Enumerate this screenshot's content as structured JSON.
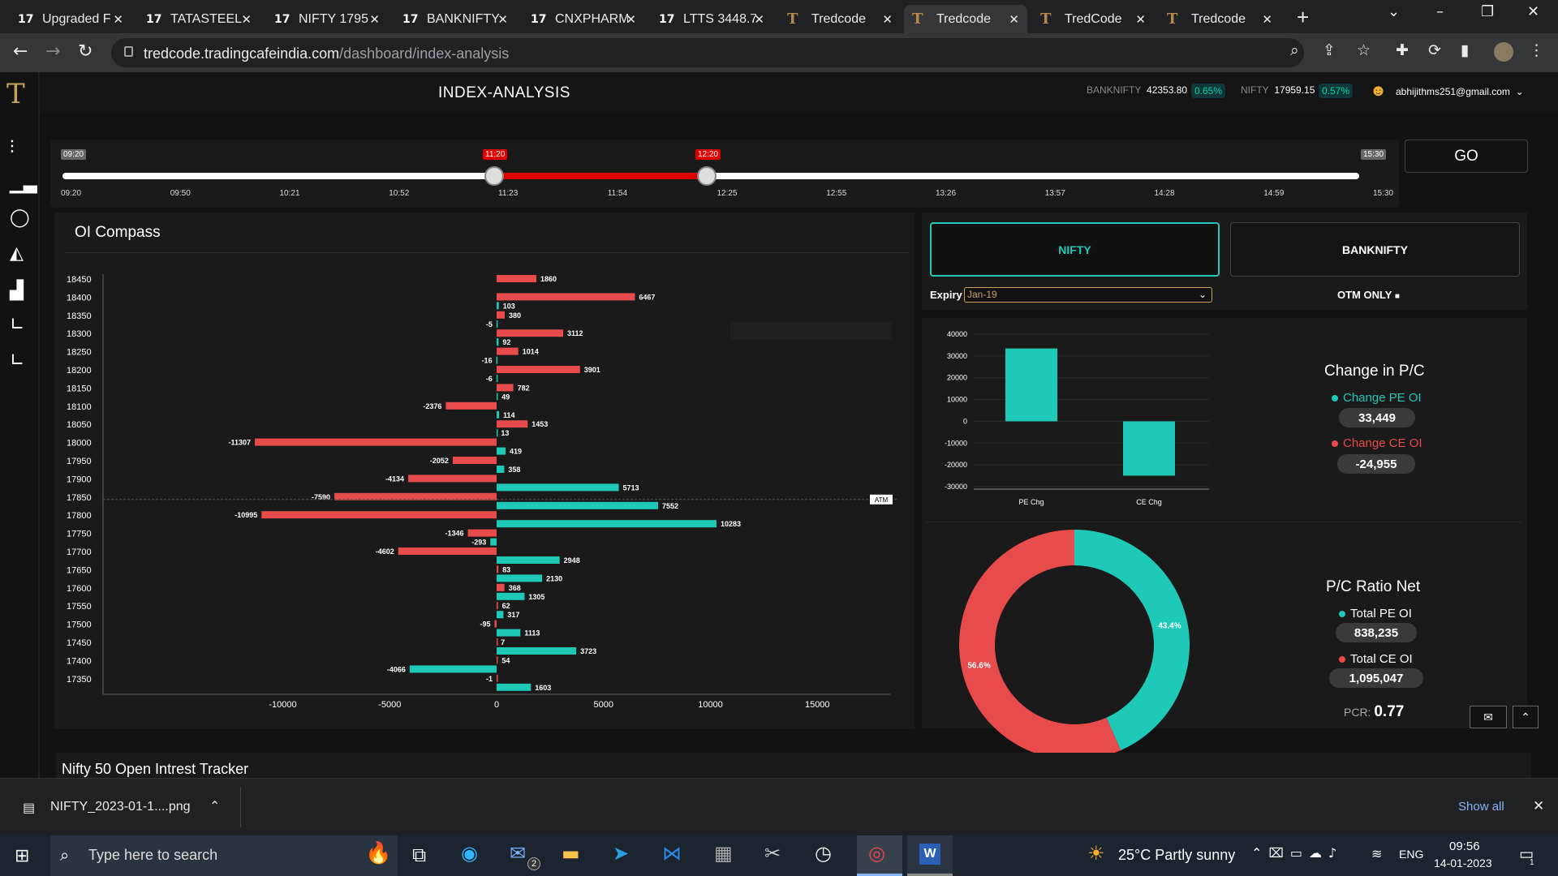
{
  "browser": {
    "tabs": [
      {
        "label": "Upgraded F",
        "icon": "tv"
      },
      {
        "label": "TATASTEEL",
        "icon": "tv"
      },
      {
        "label": "NIFTY 1795",
        "icon": "tv"
      },
      {
        "label": "BANKNIFTY",
        "icon": "tv"
      },
      {
        "label": "CNXPHARM",
        "icon": "tv"
      },
      {
        "label": "LTTS 3448.7",
        "icon": "tv"
      },
      {
        "label": "Tredcode",
        "icon": "tc"
      },
      {
        "label": "Tredcode",
        "icon": "tc"
      },
      {
        "label": "TredCode",
        "icon": "tc"
      },
      {
        "label": "Tredcode",
        "icon": "tc"
      }
    ],
    "url_host": "tredcode.tradingcafeindia.com",
    "url_path": "/dashboard/index-analysis"
  },
  "header": {
    "title": "INDEX-ANALYSIS",
    "banknifty_label": "BANKNIFTY",
    "banknifty_value": "42353.80",
    "banknifty_change": "0.65%",
    "nifty_label": "NIFTY",
    "nifty_value": "17959.15",
    "nifty_change": "0.57%",
    "user_email": "abhijithms251@gmail.com"
  },
  "slider": {
    "start_flag": "09:20",
    "from_flag": "11:20",
    "to_flag": "12:20",
    "end_flag": "15:30",
    "from_position": 0.334,
    "to_position": 0.496,
    "ticks": [
      "09:20",
      "09:50",
      "10:21",
      "10:52",
      "11:23",
      "11:54",
      "12:25",
      "12:55",
      "13:26",
      "13:57",
      "14:28",
      "14:59",
      "15:30"
    ],
    "go_label": "GO"
  },
  "oi_compass": {
    "title": "OI Compass",
    "atm_label": "ATM",
    "atm_strike": "17850",
    "x_ticks": [
      "-10000",
      "-5000",
      "0",
      "5000",
      "10000",
      "15000"
    ]
  },
  "selector": {
    "nifty_label": "NIFTY",
    "banknifty_label": "BANKNIFTY",
    "expiry_label": "Expiry",
    "expiry_value": "Jan-19",
    "otm_label": "OTM ONLY"
  },
  "change_pc": {
    "title": "Change in P/C",
    "pe_label": "Change PE OI",
    "pe_value": "33,449",
    "ce_label": "Change CE OI",
    "ce_value": "-24,955"
  },
  "pc_ratio": {
    "title": "P/C Ratio Net",
    "pe_label": "Total PE OI",
    "pe_value": "838,235",
    "ce_label": "Total CE OI",
    "ce_value": "1,095,047",
    "pcr_label": "PCR:",
    "pcr_value": "0.77"
  },
  "tracker": {
    "title": "Nifty 50 Open Intrest Tracker"
  },
  "download": {
    "file": "NIFTY_2023-01-1....png",
    "show_all": "Show all"
  },
  "taskbar": {
    "search_placeholder": "Type here to search",
    "weather": "25°C  Partly sunny",
    "lang": "ENG",
    "time": "09:56",
    "date": "14-01-2023",
    "mail_badge": "2",
    "notif_badge": "1"
  },
  "colors": {
    "put": "#1ec9b8",
    "call": "#e84b4b",
    "accent": "#c9a15c"
  },
  "chart_data": [
    {
      "type": "bar",
      "title": "OI Compass",
      "orientation": "horizontal",
      "categories": [
        "18450",
        "18400",
        "18350",
        "18300",
        "18250",
        "18200",
        "18150",
        "18100",
        "18050",
        "18000",
        "17950",
        "17900",
        "17850",
        "17800",
        "17750",
        "17700",
        "17650",
        "17600",
        "17550",
        "17500",
        "17450",
        "17400",
        "17350"
      ],
      "series": [
        {
          "values": [
            1860,
            6467,
            380,
            3112,
            1014,
            3901,
            782,
            -2376,
            1453,
            -11307,
            -2052,
            -4134,
            -7590,
            -10995,
            -1346,
            -4602,
            83,
            368,
            62,
            -95,
            7,
            54,
            -1
          ]
        },
        {
          "values": [
            null,
            103,
            -5,
            92,
            -16,
            -6,
            49,
            114,
            13,
            419,
            358,
            5713,
            7552,
            10283,
            -293,
            2948,
            2130,
            1305,
            317,
            1113,
            3723,
            -4066,
            1603
          ]
        }
      ],
      "xlim": [
        -15000,
        15000
      ]
    },
    {
      "type": "bar",
      "categories": [
        "PE Chg",
        "CE Chg"
      ],
      "values": [
        33449,
        -24955
      ],
      "ylim": [
        -30000,
        40000
      ],
      "y_ticks": [
        "40000",
        "30000",
        "20000",
        "10000",
        "0",
        "-10000",
        "-20000",
        "-30000"
      ]
    },
    {
      "type": "pie",
      "donut": true,
      "labels": [
        "Total PE OI",
        "Total CE OI"
      ],
      "values": [
        43.4,
        56.6
      ],
      "value_labels": [
        "43.4%",
        "56.6%"
      ]
    }
  ]
}
